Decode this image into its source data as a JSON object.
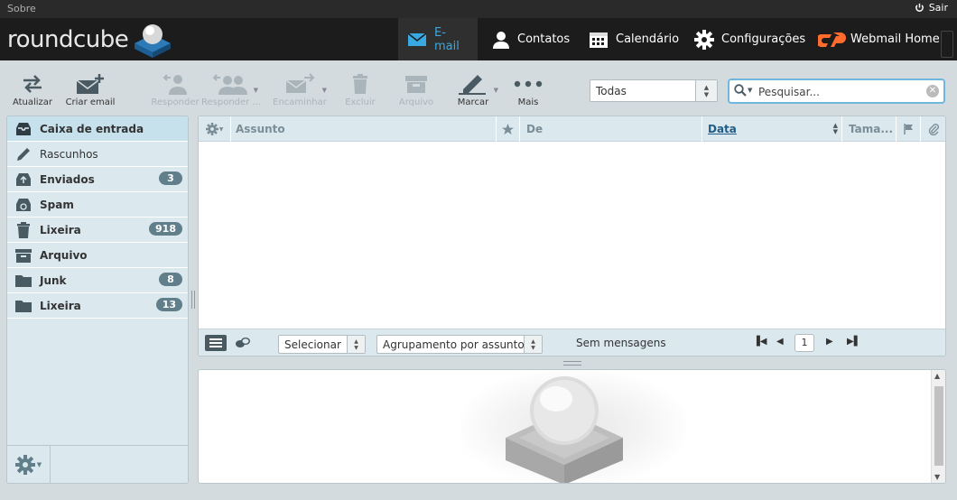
{
  "topbar": {
    "about": "Sobre",
    "logout": "Sair"
  },
  "logo": {
    "text": "roundcube"
  },
  "nav": [
    {
      "label": "E-mail",
      "icon": "envelope-icon",
      "active": true
    },
    {
      "label": "Contatos",
      "icon": "person-icon"
    },
    {
      "label": "Calendário",
      "icon": "calendar-icon"
    },
    {
      "label": "Configurações",
      "icon": "gear-icon"
    },
    {
      "label": "Webmail Home",
      "icon": "cpanel-icon"
    }
  ],
  "toolbar": {
    "refresh": "Atualizar",
    "compose": "Criar email",
    "reply": "Responder",
    "reply_all": "Responder ...",
    "forward": "Encaminhar",
    "delete": "Excluir",
    "archive": "Arquivo",
    "mark": "Marcar",
    "more": "Mais"
  },
  "filter": {
    "selected": "Todas"
  },
  "search": {
    "placeholder": "Pesquisar..."
  },
  "folders": [
    {
      "name": "Caixa de entrada",
      "icon": "inbox-icon",
      "count": ""
    },
    {
      "name": "Rascunhos",
      "icon": "pencil-icon",
      "count": ""
    },
    {
      "name": "Enviados",
      "icon": "sent-icon",
      "count": "3"
    },
    {
      "name": "Spam",
      "icon": "spam-icon",
      "count": ""
    },
    {
      "name": "Lixeira",
      "icon": "trash-icon",
      "count": "918"
    },
    {
      "name": "Arquivo",
      "icon": "archive-icon",
      "count": ""
    },
    {
      "name": "Junk",
      "icon": "folder-icon",
      "count": "8"
    },
    {
      "name": "Lixeira",
      "icon": "folder-icon",
      "count": "13"
    }
  ],
  "list_columns": {
    "subject": "Assunto",
    "from": "De",
    "date": "Data",
    "size": "Tama..."
  },
  "list_footer": {
    "select": "Selecionar",
    "threads": "Agrupamento por assunto",
    "status": "Sem mensagens",
    "page": "1"
  },
  "colors": {
    "accent": "#38a9e2",
    "header_bg": "#1c1c1c",
    "panel_bg": "#dbe9ef",
    "badge": "#617e8b",
    "cpanel": "#ff6c2c"
  }
}
